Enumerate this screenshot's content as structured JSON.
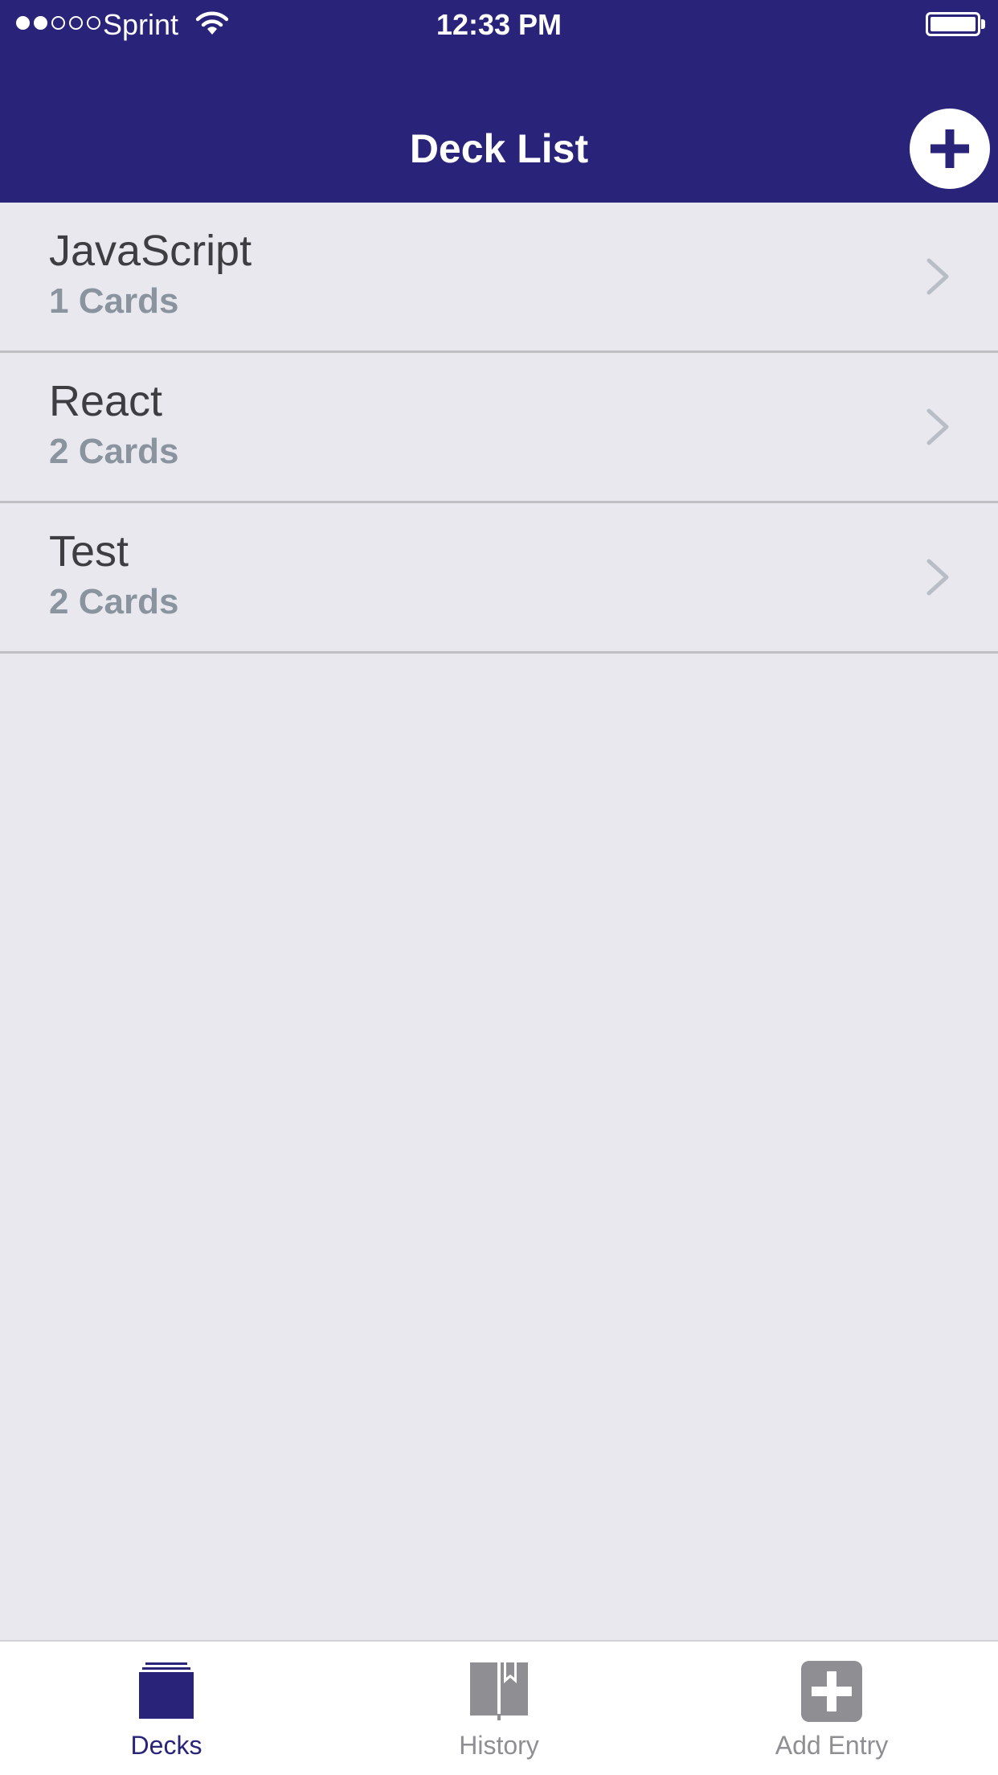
{
  "status_bar": {
    "carrier": "Sprint",
    "time": "12:33 PM",
    "signal_bars_filled": 2,
    "signal_bars_total": 5
  },
  "nav": {
    "title": "Deck List",
    "add_icon": "plus-circle-icon"
  },
  "decks": [
    {
      "title": "JavaScript",
      "count": "1 Cards"
    },
    {
      "title": "React",
      "count": "2 Cards"
    },
    {
      "title": "Test",
      "count": "2 Cards"
    }
  ],
  "tabs": [
    {
      "label": "Decks",
      "icon": "decks-icon",
      "active": true
    },
    {
      "label": "History",
      "icon": "book-icon",
      "active": false
    },
    {
      "label": "Add Entry",
      "icon": "plus-square-icon",
      "active": false
    }
  ],
  "colors": {
    "primary": "#292379",
    "background": "#e9e8ef",
    "inactive_tab": "#8e8e93",
    "subtitle": "#8a949e"
  }
}
